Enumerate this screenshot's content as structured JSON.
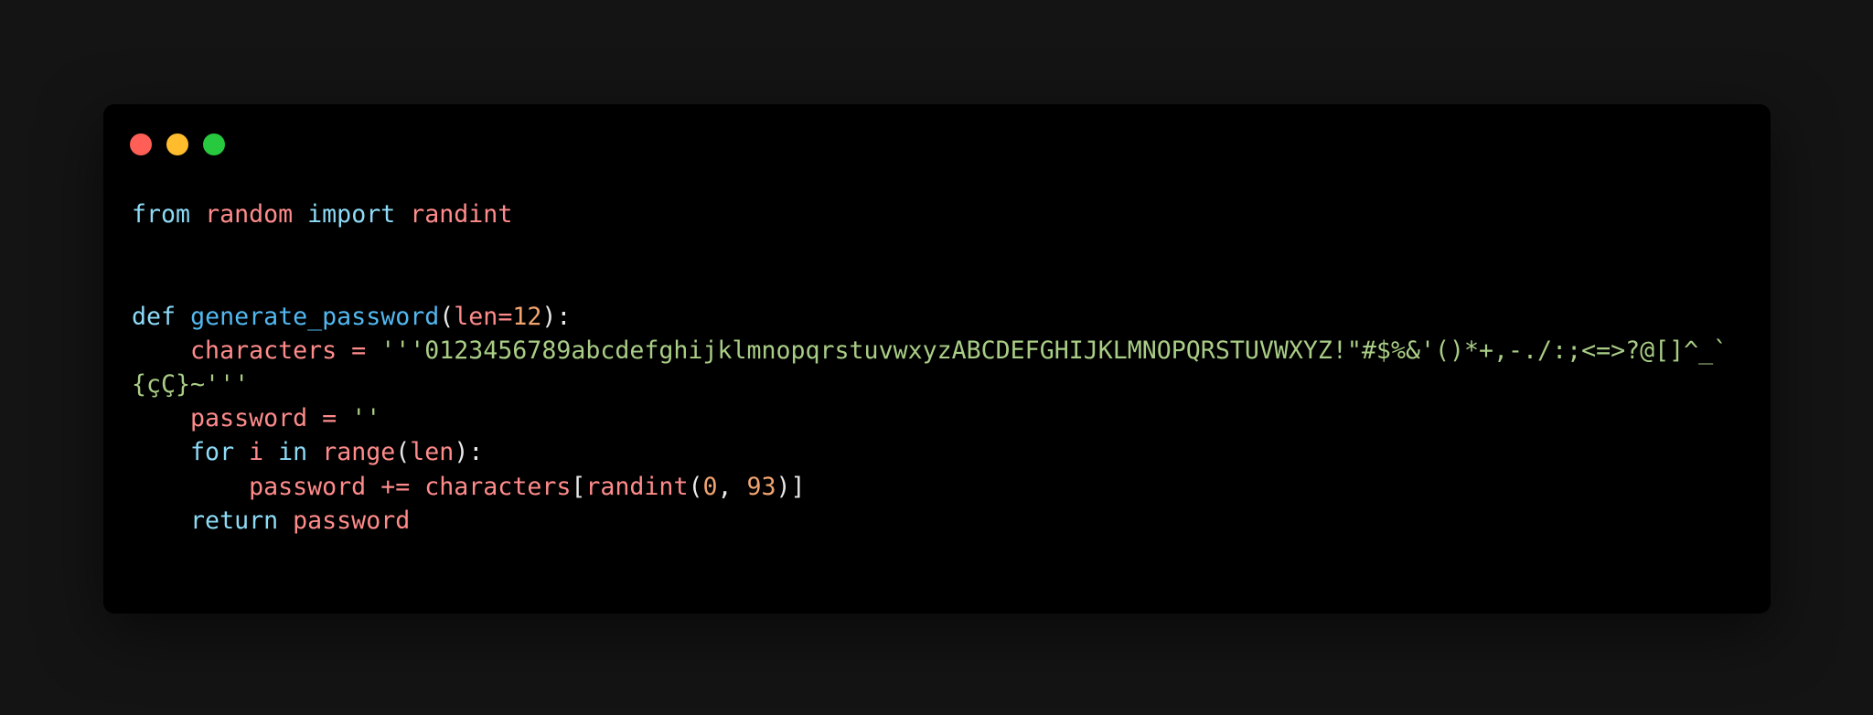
{
  "colors": {
    "page_background": "#141414",
    "window_background": "#000000",
    "close": "#ff5f56",
    "minimize": "#ffbd2e",
    "maximize": "#27c93f",
    "keyword": "#8ddbf7",
    "function_name": "#52b8f0",
    "identifier": "#ff8b8b",
    "number": "#f0a470",
    "string": "#a9cd86",
    "punctuation": "#e8e8e8"
  },
  "window_controls": [
    "close-dot",
    "minimize-dot",
    "maximize-dot"
  ],
  "code": {
    "language": "python",
    "lines": [
      [
        {
          "t": "from",
          "c": "keyword"
        },
        {
          "t": " ",
          "c": "punctuation"
        },
        {
          "t": "random",
          "c": "identifier"
        },
        {
          "t": " ",
          "c": "punctuation"
        },
        {
          "t": "import",
          "c": "keyword"
        },
        {
          "t": " ",
          "c": "punctuation"
        },
        {
          "t": "randint",
          "c": "identifier"
        }
      ],
      [],
      [],
      [
        {
          "t": "def",
          "c": "keyword"
        },
        {
          "t": " ",
          "c": "punctuation"
        },
        {
          "t": "generate_password",
          "c": "function_name"
        },
        {
          "t": "(",
          "c": "punctuation"
        },
        {
          "t": "len",
          "c": "identifier"
        },
        {
          "t": "=",
          "c": "identifier"
        },
        {
          "t": "12",
          "c": "number"
        },
        {
          "t": "):",
          "c": "punctuation"
        }
      ],
      [
        {
          "t": "    ",
          "c": "punctuation"
        },
        {
          "t": "characters",
          "c": "identifier"
        },
        {
          "t": " ",
          "c": "punctuation"
        },
        {
          "t": "=",
          "c": "identifier"
        },
        {
          "t": " ",
          "c": "punctuation"
        },
        {
          "t": "'''0123456789abcdefghijklmnopqrstuvwxyzABCDEFGHIJKLMNOPQRSTUVWXYZ!\"#$%&'()*+,-./:;<=>?@[]^_`{çÇ}~'''",
          "c": "string"
        }
      ],
      [
        {
          "t": "    ",
          "c": "punctuation"
        },
        {
          "t": "password",
          "c": "identifier"
        },
        {
          "t": " ",
          "c": "punctuation"
        },
        {
          "t": "=",
          "c": "identifier"
        },
        {
          "t": " ",
          "c": "punctuation"
        },
        {
          "t": "''",
          "c": "string"
        }
      ],
      [
        {
          "t": "    ",
          "c": "punctuation"
        },
        {
          "t": "for",
          "c": "keyword"
        },
        {
          "t": " ",
          "c": "punctuation"
        },
        {
          "t": "i",
          "c": "identifier"
        },
        {
          "t": " ",
          "c": "punctuation"
        },
        {
          "t": "in",
          "c": "keyword"
        },
        {
          "t": " ",
          "c": "punctuation"
        },
        {
          "t": "range",
          "c": "identifier"
        },
        {
          "t": "(",
          "c": "punctuation"
        },
        {
          "t": "len",
          "c": "identifier"
        },
        {
          "t": "):",
          "c": "punctuation"
        }
      ],
      [
        {
          "t": "        ",
          "c": "punctuation"
        },
        {
          "t": "password",
          "c": "identifier"
        },
        {
          "t": " ",
          "c": "punctuation"
        },
        {
          "t": "+=",
          "c": "identifier"
        },
        {
          "t": " ",
          "c": "punctuation"
        },
        {
          "t": "characters",
          "c": "identifier"
        },
        {
          "t": "[",
          "c": "punctuation"
        },
        {
          "t": "randint",
          "c": "identifier"
        },
        {
          "t": "(",
          "c": "punctuation"
        },
        {
          "t": "0",
          "c": "number"
        },
        {
          "t": ", ",
          "c": "punctuation"
        },
        {
          "t": "93",
          "c": "number"
        },
        {
          "t": ")]",
          "c": "punctuation"
        }
      ],
      [
        {
          "t": "    ",
          "c": "punctuation"
        },
        {
          "t": "return",
          "c": "keyword"
        },
        {
          "t": " ",
          "c": "punctuation"
        },
        {
          "t": "password",
          "c": "identifier"
        }
      ]
    ]
  }
}
